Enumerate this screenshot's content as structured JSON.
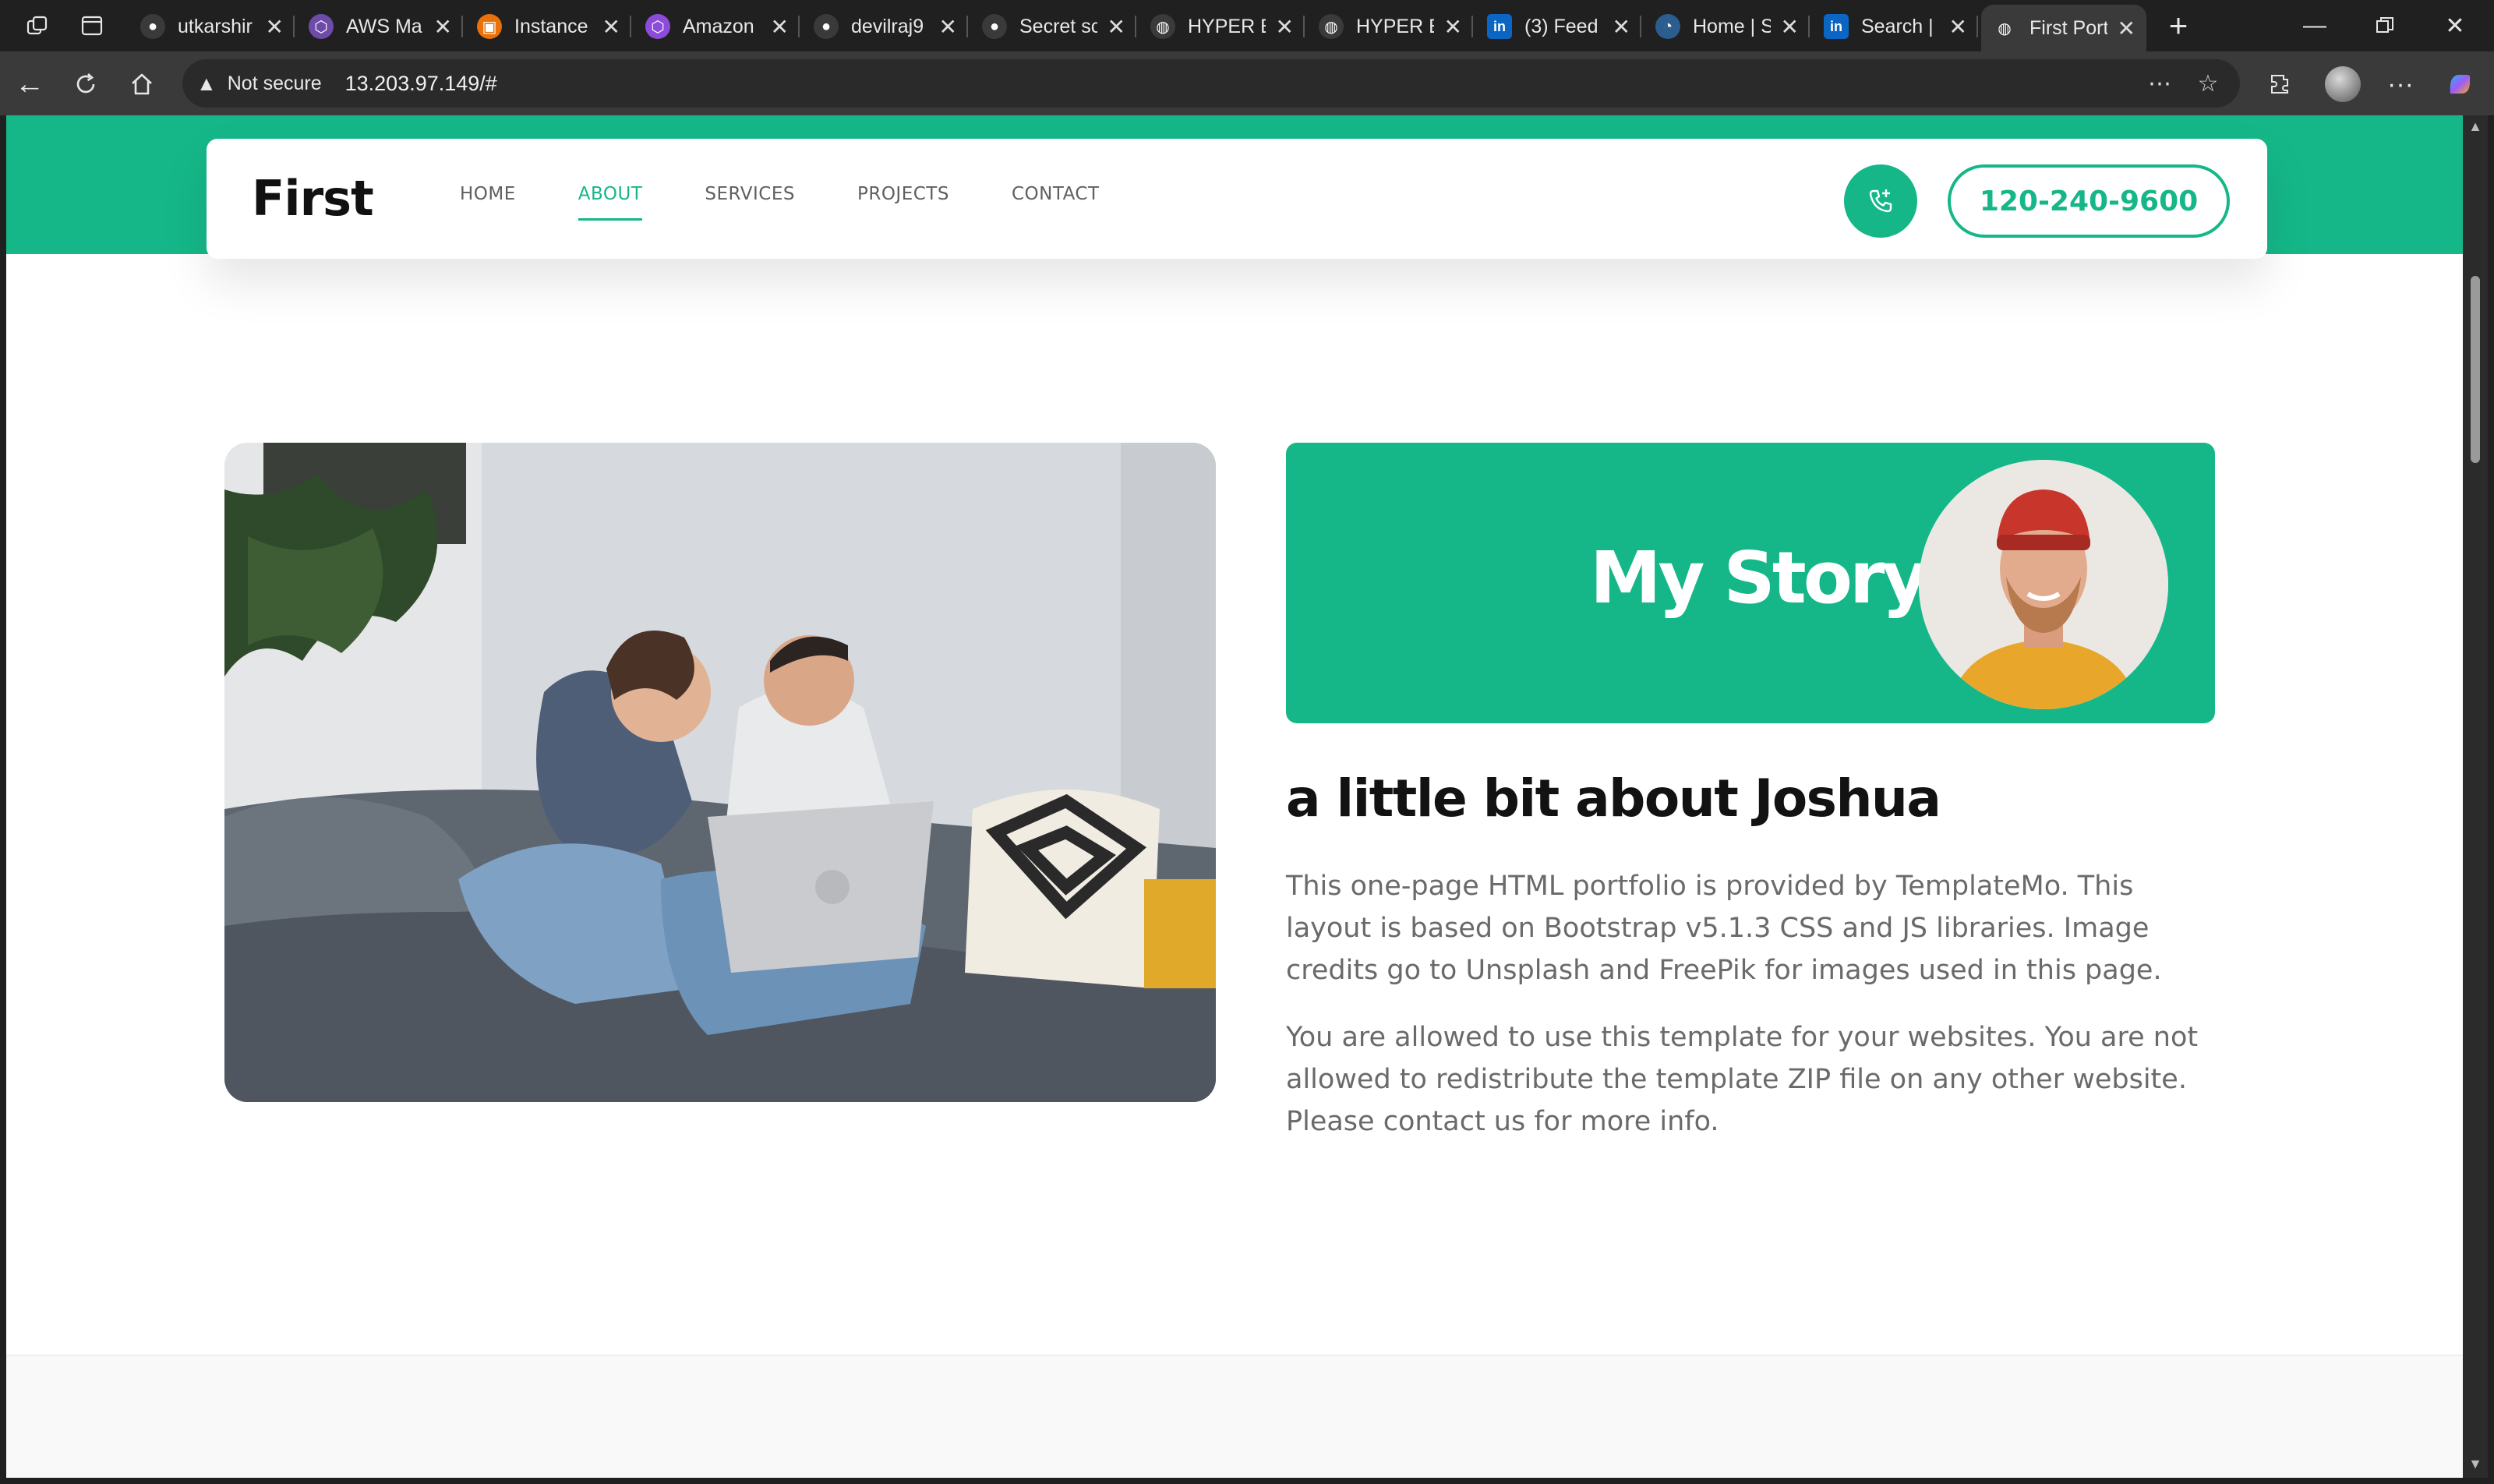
{
  "browser": {
    "tabs": [
      {
        "label": "utkarshir",
        "favicon": "github-icon",
        "color": "#3a3a3a"
      },
      {
        "label": "AWS Ma",
        "favicon": "aws-cube-icon",
        "color": "#6e4ba8"
      },
      {
        "label": "Instance",
        "favicon": "aws-ec2-icon",
        "color": "#e8710a"
      },
      {
        "label": "Amazon",
        "favicon": "aws-cube-icon",
        "color": "#8c4bd8"
      },
      {
        "label": "devilraj9",
        "favicon": "github-icon",
        "color": "#3a3a3a"
      },
      {
        "label": "Secret sc",
        "favicon": "github-icon",
        "color": "#3a3a3a"
      },
      {
        "label": "HYPER E",
        "favicon": "globe-icon",
        "color": "#3a3a3a"
      },
      {
        "label": "HYPER E",
        "favicon": "globe-icon",
        "color": "#3a3a3a"
      },
      {
        "label": "(3) Feed",
        "favicon": "linkedin-icon",
        "color": "#0a66c2"
      },
      {
        "label": "Home | S",
        "favicon": "sonar-icon",
        "color": "#2c5d8f"
      },
      {
        "label": "Search |",
        "favicon": "linkedin-icon",
        "color": "#0a66c2"
      },
      {
        "label": "First Port",
        "favicon": "globe-icon",
        "color": "#3a3a3a",
        "active": true
      }
    ],
    "security_label": "Not secure",
    "url": "13.203.97.149/#"
  },
  "site": {
    "brand": "First",
    "nav": {
      "home": "HOME",
      "about": "ABOUT",
      "services": "SERVICES",
      "projects": "PROJECTS",
      "contact": "CONTACT"
    },
    "phone": "120-240-9600",
    "accent_color": "#15b788"
  },
  "about": {
    "story_heading": "My Story",
    "title": "a little bit about Joshua",
    "paragraph1": "This one-page HTML portfolio is provided by TemplateMo. This layout is based on Bootstrap v5.1.3 CSS and JS libraries. Image credits go to Unsplash and FreePik for images used in this page.",
    "paragraph2": "You are allowed to use this template for your websites. You are not allowed to redistribute the template ZIP file on any other website. Please contact us for more info."
  }
}
